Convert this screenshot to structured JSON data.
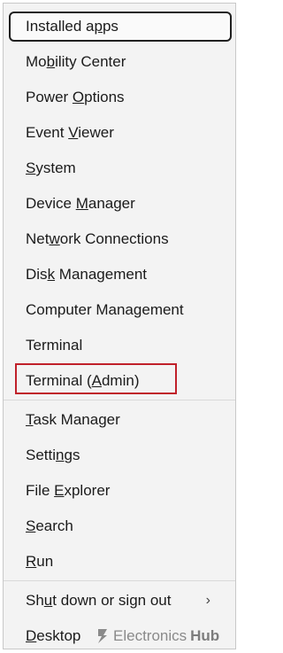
{
  "menu": {
    "items": [
      {
        "label": "Installed apps",
        "prefix": "Installed a",
        "key": "p",
        "suffix": "ps"
      },
      {
        "label": "Mobility Center",
        "prefix": "Mo",
        "key": "b",
        "suffix": "ility Center"
      },
      {
        "label": "Power Options",
        "prefix": "Power ",
        "key": "O",
        "suffix": "ptions"
      },
      {
        "label": "Event Viewer",
        "prefix": "Event ",
        "key": "V",
        "suffix": "iewer"
      },
      {
        "label": "System",
        "prefix": "",
        "key": "S",
        "suffix": "ystem"
      },
      {
        "label": "Device Manager",
        "prefix": "Device ",
        "key": "M",
        "suffix": "anager"
      },
      {
        "label": "Network Connections",
        "prefix": "Net",
        "key": "w",
        "suffix": "ork Connections"
      },
      {
        "label": "Disk Management",
        "prefix": "Dis",
        "key": "k",
        "suffix": " Management"
      },
      {
        "label": "Computer Management",
        "prefix": "Computer Mana",
        "key": "g",
        "suffix": "ement"
      },
      {
        "label": "Terminal",
        "prefix": "Terminal",
        "key": "",
        "suffix": ""
      },
      {
        "label": "Terminal (Admin)",
        "prefix": "Terminal (",
        "key": "A",
        "suffix": "dmin)"
      },
      {
        "label": "Task Manager",
        "prefix": "",
        "key": "T",
        "suffix": "ask Manager"
      },
      {
        "label": "Settings",
        "prefix": "Setti",
        "key": "n",
        "suffix": "gs"
      },
      {
        "label": "File Explorer",
        "prefix": "File ",
        "key": "E",
        "suffix": "xplorer"
      },
      {
        "label": "Search",
        "prefix": "",
        "key": "S",
        "suffix": "earch"
      },
      {
        "label": "Run",
        "prefix": "",
        "key": "R",
        "suffix": "un"
      },
      {
        "label": "Shut down or sign out",
        "prefix": "Sh",
        "key": "u",
        "suffix": "t down or sign out"
      },
      {
        "label": "Desktop",
        "prefix": "",
        "key": "D",
        "suffix": "esktop"
      }
    ],
    "submenu_arrow": "›",
    "highlighted_item": "Terminal (Admin)"
  },
  "watermark": {
    "brand_light": "Electronics",
    "brand_bold": "Hub"
  },
  "colors": {
    "highlight_border": "#c0202a",
    "menu_bg": "#f3f3f3",
    "text": "#1b1b1b"
  }
}
